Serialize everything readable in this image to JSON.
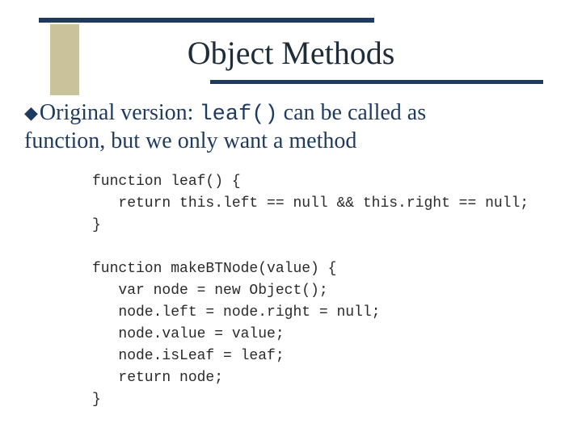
{
  "title": "Object Methods",
  "bullet": {
    "line1_pre": "Original version: ",
    "line1_code": "leaf()",
    "line1_post": " can be called as",
    "line2": "function, but we only want a method"
  },
  "code": "function leaf() {\n   return this.left == null && this.right == null;\n}\n\nfunction makeBTNode(value) {\n   var node = new Object();\n   node.left = node.right = null;\n   node.value = value;\n   node.isLeaf = leaf;\n   return node;\n}"
}
